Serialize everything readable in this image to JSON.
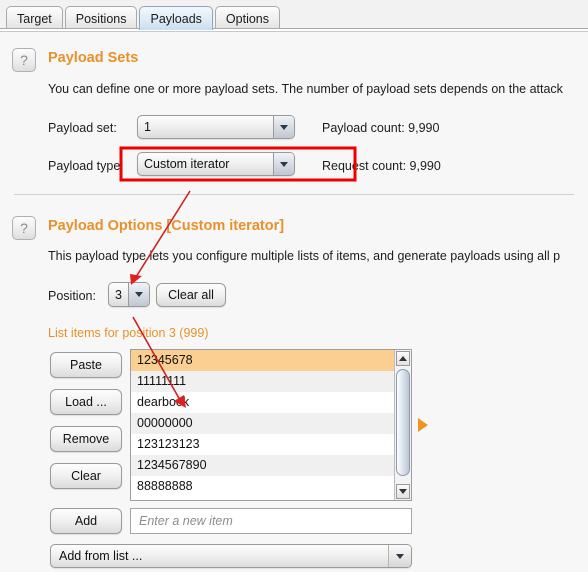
{
  "window": {
    "app": "Burp Suite Intruder"
  },
  "tabs": [
    {
      "label": "Target",
      "selected": false
    },
    {
      "label": "Positions",
      "selected": false
    },
    {
      "label": "Payloads",
      "selected": true
    },
    {
      "label": "Options",
      "selected": false
    }
  ],
  "payload_sets": {
    "help_icon": "question-mark-icon",
    "title": "Payload Sets",
    "description": "You can define one or more payload sets. The number of payload sets depends on the attack",
    "payload_set_label": "Payload set:",
    "payload_set_value": "1",
    "payload_count_label": "Payload count:  9,990",
    "payload_type_label": "Payload type:",
    "payload_type_value": "Custom iterator",
    "request_count_label": "Request count:  9,990"
  },
  "payload_options": {
    "help_icon": "question-mark-icon",
    "title": "Payload Options [Custom iterator]",
    "description": "This payload type lets you configure multiple lists of items, and generate payloads using all p",
    "position_label": "Position:",
    "position_value": "3",
    "clear_all_label": "Clear all",
    "list_header": "List items for position 3 (999)",
    "side_buttons": [
      {
        "label": "Paste"
      },
      {
        "label": "Load ..."
      },
      {
        "label": "Remove"
      },
      {
        "label": "Clear"
      }
    ],
    "list_items": [
      {
        "text": "12345678",
        "selected": true
      },
      {
        "text": "11111111",
        "selected": false
      },
      {
        "text": "dearbook",
        "selected": false
      },
      {
        "text": "00000000",
        "selected": false
      },
      {
        "text": "123123123",
        "selected": false
      },
      {
        "text": "1234567890",
        "selected": false
      },
      {
        "text": "88888888",
        "selected": false
      }
    ],
    "add_button_label": "Add",
    "new_item_placeholder": "Enter a new item",
    "new_item_value": "",
    "add_from_list_label": "Add from list ..."
  },
  "annotations": {
    "box_color": "#ee0000",
    "arrow_color": "#cc2222",
    "marker_color": "#f0941f",
    "marker_icon": "right-triangle-marker"
  },
  "colors": {
    "accent_orange": "#e8912a",
    "selection_orange": "#fbcf92",
    "tab_selected": "#dfebf6"
  }
}
